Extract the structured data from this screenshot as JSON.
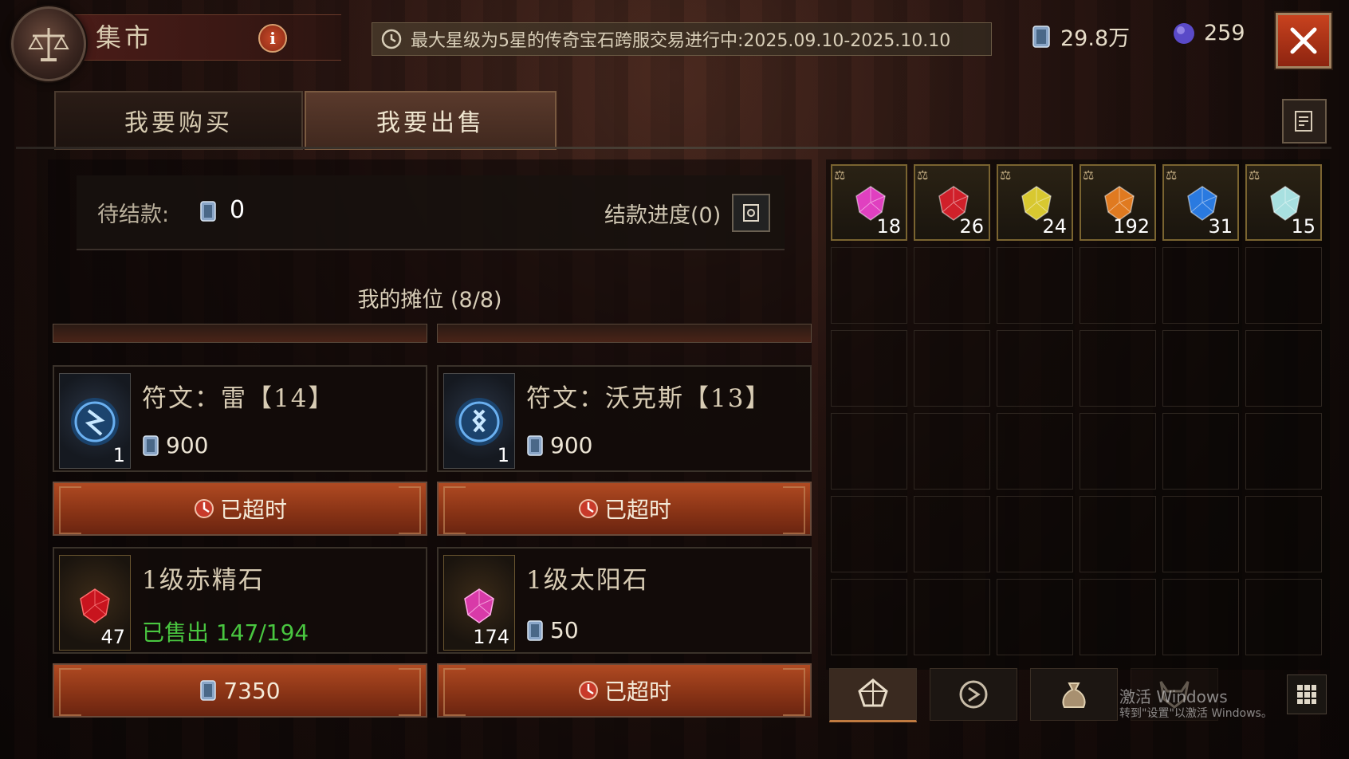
{
  "header": {
    "title": "集市",
    "notice": "最大星级为5星的传奇宝石跨服交易进行中:2025.09.10-2025.10.10",
    "currency_platinum": "29.8万",
    "currency_orbs": "259"
  },
  "tabs": [
    {
      "label": "我要购买",
      "active": false
    },
    {
      "label": "我要出售",
      "active": true
    }
  ],
  "payment": {
    "label": "待结款:",
    "amount": "0",
    "progress_label": "结款进度(0)"
  },
  "stall": {
    "title": "我的摊位 (8/8)",
    "items": [
      {
        "name": "符文：雷【14】",
        "qty": "1",
        "price": "900",
        "button": "已超时",
        "icon": "rune-icon"
      },
      {
        "name": "符文：沃克斯【13】",
        "qty": "1",
        "price": "900",
        "button": "已超时",
        "icon": "rune-icon"
      },
      {
        "name": "1级赤精石",
        "qty": "47",
        "sold": "已售出 147/194",
        "button": "7350",
        "icon": "red-gem-icon"
      },
      {
        "name": "1级太阳石",
        "qty": "174",
        "price": "50",
        "button": "已超时",
        "icon": "pink-gem-icon"
      }
    ]
  },
  "inventory": {
    "gems": [
      {
        "qty": "18",
        "color": "#e040c0",
        "name": "pink-gem-icon"
      },
      {
        "qty": "26",
        "color": "#d0202a",
        "name": "red-gem-icon"
      },
      {
        "qty": "24",
        "color": "#d8c830",
        "name": "yellow-gem-icon"
      },
      {
        "qty": "192",
        "color": "#e07a20",
        "name": "orange-gem-icon"
      },
      {
        "qty": "31",
        "color": "#2a7ae0",
        "name": "blue-gem-icon"
      },
      {
        "qty": "15",
        "color": "#a8e0e0",
        "name": "cyan-gem-icon"
      }
    ]
  },
  "watermark": {
    "line1": "激活 Windows",
    "line2": "转到\"设置\"以激活 Windows。"
  },
  "colors": {
    "accent_button": "#8a3416",
    "sold_text": "#49c640",
    "close_button": "#c8421e"
  }
}
